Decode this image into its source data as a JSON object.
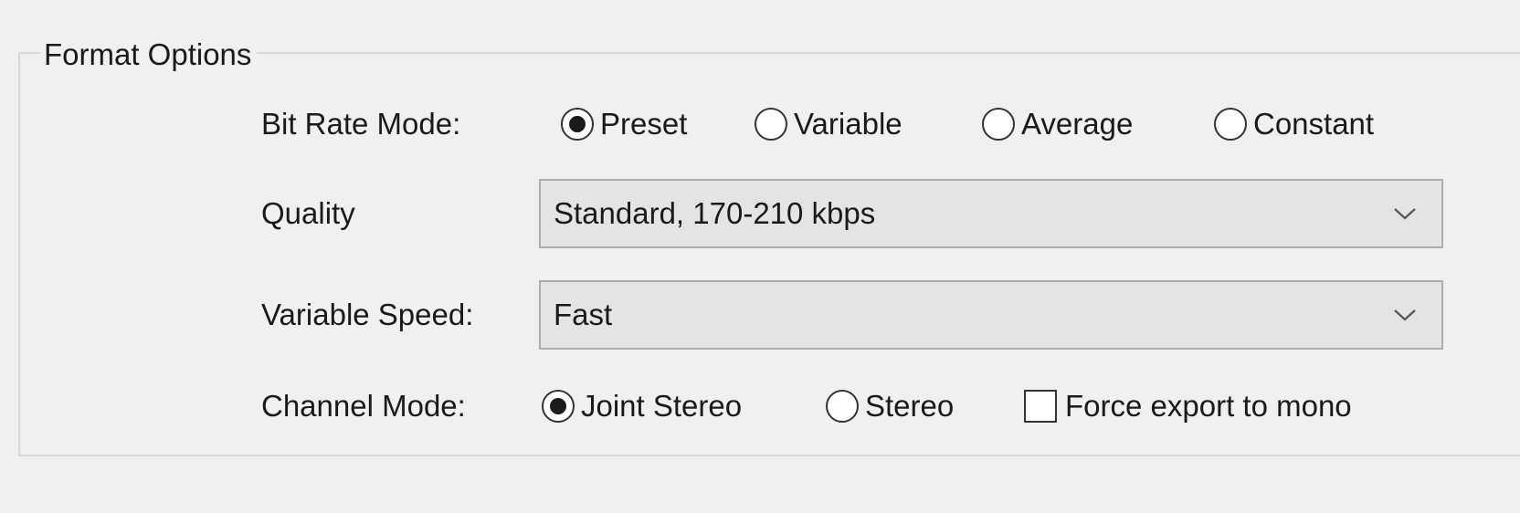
{
  "group": {
    "title": "Format Options"
  },
  "bit_rate_mode": {
    "label": "Bit Rate Mode:",
    "options": [
      {
        "label": "Preset",
        "checked": true
      },
      {
        "label": "Variable",
        "checked": false
      },
      {
        "label": "Average",
        "checked": false
      },
      {
        "label": "Constant",
        "checked": false
      }
    ]
  },
  "quality": {
    "label": "Quality",
    "value": "Standard, 170-210 kbps"
  },
  "variable_speed": {
    "label": "Variable Speed:",
    "value": "Fast"
  },
  "channel_mode": {
    "label": "Channel Mode:",
    "options": [
      {
        "label": "Joint Stereo",
        "checked": true
      },
      {
        "label": "Stereo",
        "checked": false
      }
    ],
    "force_mono": {
      "label": "Force export to mono",
      "checked": false
    }
  },
  "icons": {
    "dropdown_arrow": "chevron-down-icon"
  },
  "colors": {
    "background": "#f0f0f0",
    "dropdown_fill": "#e4e4e4",
    "dropdown_border": "#adadad",
    "groupbox_border": "#d9d9d9"
  }
}
